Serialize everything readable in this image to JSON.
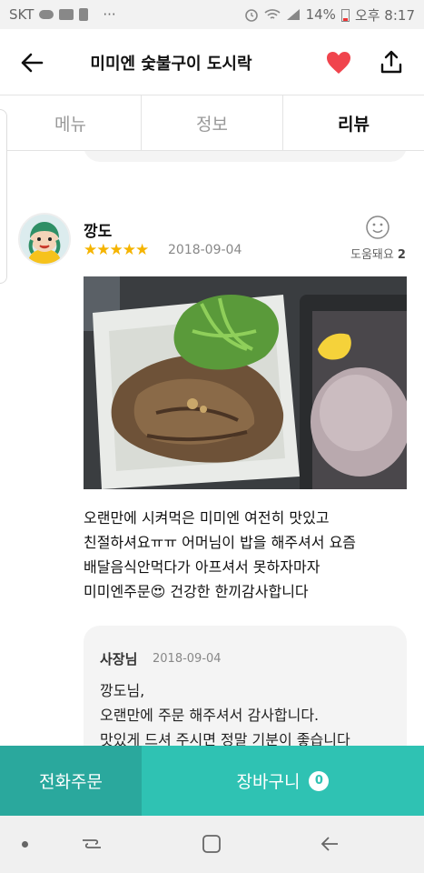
{
  "status_bar": {
    "carrier": "SKT",
    "more": "···",
    "battery": "14%",
    "time": "오후 8:17"
  },
  "app_bar": {
    "title": "미미엔 숯불구이 도시락"
  },
  "tabs": [
    {
      "label": "메뉴",
      "active": false
    },
    {
      "label": "정보",
      "active": false
    },
    {
      "label": "리뷰",
      "active": true
    }
  ],
  "review": {
    "nickname": "깡도",
    "stars": "★★★★★",
    "date": "2018-09-04",
    "helpful_label": "도움돼요",
    "helpful_count": "2",
    "text_lines": [
      "오랜만에 시켜먹은 미미엔 여전히 맛있고",
      "친절하셔요ㅠㅠ 어머님이 밥을 해주셔서 요즘",
      "배달음식안먹다가 아프셔서 못하자마자",
      "미미엔주문😍 건강한 한끼감사합니다"
    ],
    "reply": {
      "owner": "사장님",
      "date": "2018-09-04",
      "lines": [
        "깡도님,",
        "오랜만에 주문 해주셔서 감사합니다.",
        "맛있게 드셔 주시면 정말 기분이 좋습니다"
      ]
    }
  },
  "bottom_bar": {
    "call_label": "전화주문",
    "cart_label": "장바구니",
    "cart_count": "0"
  },
  "colors": {
    "accent_dark": "#2aa89d",
    "accent": "#2fc2b3",
    "heart": "#f0444d",
    "star": "#f5b400"
  }
}
